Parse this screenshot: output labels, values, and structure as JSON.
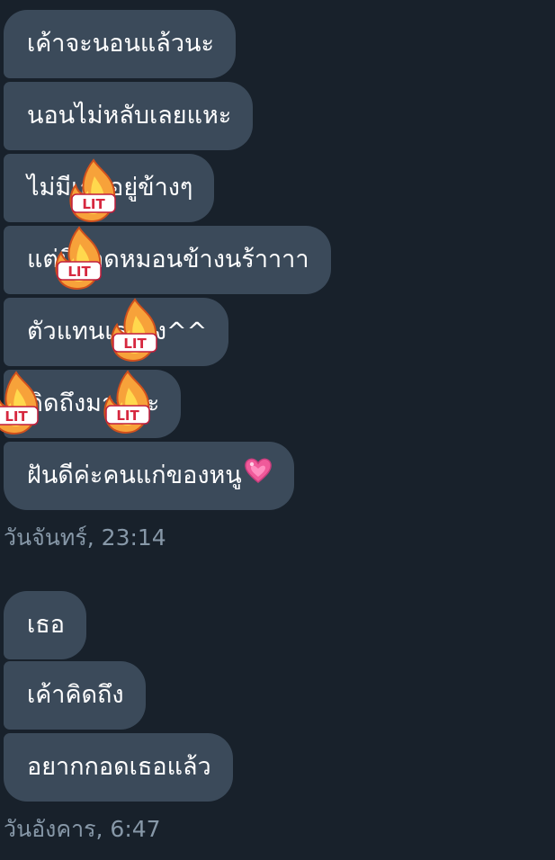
{
  "messages_group_1": [
    {
      "text": "เค้าจะนอนแล้วนะ"
    },
    {
      "text": "นอนไม่หลับเลยแหะ"
    },
    {
      "text": "ไม่มีเธออยู่ข้างๆ"
    },
    {
      "text": "แต่มีกอดหมอนข้างนร้าาาา"
    },
    {
      "text": "ตัวแทนเธอไง^^"
    },
    {
      "text": "คิดถึงมากนะ"
    },
    {
      "text": "ฝันดีค่ะคนแก่ของหนู"
    }
  ],
  "timestamp_1": "วันจันทร์, 23:14",
  "messages_group_2": [
    {
      "text": "เธอ"
    },
    {
      "text": "เค้าคิดถึง"
    },
    {
      "text": "อยากกอดเธอแล้ว"
    }
  ],
  "timestamp_2": "วันอังคาร, 6:47",
  "sticker_label": "LIT",
  "colors": {
    "background": "#18212b",
    "bubble": "#3b4a5a",
    "text": "#ffffff",
    "timestamp": "#8798a8",
    "heart": "#f05a9a"
  },
  "icons": {
    "heart": "heart-emoji-icon",
    "sticker": "lit-fire-sticker-icon"
  }
}
